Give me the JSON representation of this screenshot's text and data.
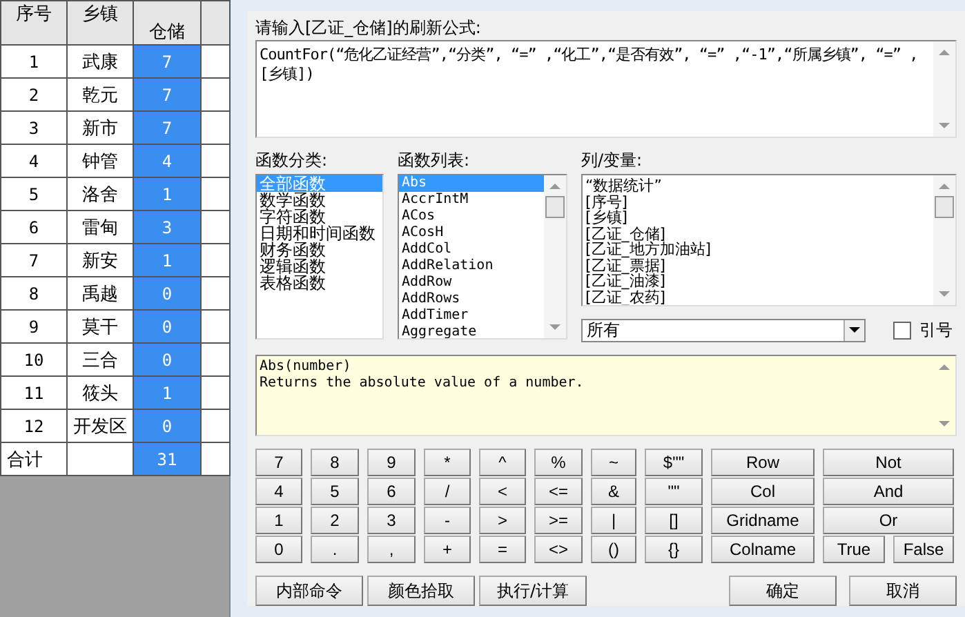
{
  "table": {
    "columns": [
      "序号",
      "乡镇",
      "仓储"
    ],
    "rows": [
      {
        "no": "1",
        "town": "武康",
        "value": "7"
      },
      {
        "no": "2",
        "town": "乾元",
        "value": "7"
      },
      {
        "no": "3",
        "town": "新市",
        "value": "7"
      },
      {
        "no": "4",
        "town": "钟管",
        "value": "4"
      },
      {
        "no": "5",
        "town": "洛舍",
        "value": "1"
      },
      {
        "no": "6",
        "town": "雷甸",
        "value": "3"
      },
      {
        "no": "7",
        "town": "新安",
        "value": "1"
      },
      {
        "no": "8",
        "town": "禹越",
        "value": "0"
      },
      {
        "no": "9",
        "town": "莫干",
        "value": "0"
      },
      {
        "no": "10",
        "town": "三合",
        "value": "0"
      },
      {
        "no": "11",
        "town": "筱头",
        "value": "1"
      },
      {
        "no": "12",
        "town": "开发区",
        "value": "0"
      }
    ],
    "total": {
      "label": "合计",
      "value": "31"
    }
  },
  "dialog": {
    "prompt": "请输入[乙证_仓储]的刷新公式:",
    "formula": "CountFor(“危化乙证经营”,“分类”, “=” ,“化工”,“是否有效”, “=” ,“-1”,“所属乡镇”, “=” ,[乡镇])",
    "category_label": "函数分类:",
    "categories": [
      {
        "label": "全部函数",
        "selected": true
      },
      {
        "label": "数学函数",
        "selected": false
      },
      {
        "label": "字符函数",
        "selected": false
      },
      {
        "label": "日期和时间函数",
        "selected": false
      },
      {
        "label": "财务函数",
        "selected": false
      },
      {
        "label": "逻辑函数",
        "selected": false
      },
      {
        "label": "表格函数",
        "selected": false
      }
    ],
    "function_label": "函数列表:",
    "functions": [
      {
        "label": "Abs",
        "selected": true
      },
      {
        "label": "AccrIntM",
        "selected": false
      },
      {
        "label": "ACos",
        "selected": false
      },
      {
        "label": "ACosH",
        "selected": false
      },
      {
        "label": "AddCol",
        "selected": false
      },
      {
        "label": "AddRelation",
        "selected": false
      },
      {
        "label": "AddRow",
        "selected": false
      },
      {
        "label": "AddRows",
        "selected": false
      },
      {
        "label": "AddTimer",
        "selected": false
      },
      {
        "label": "Aggregate",
        "selected": false
      }
    ],
    "variable_label": "列/变量:",
    "variables": [
      "“数据统计”",
      "[序号]",
      "[乡镇]",
      "[乙证_仓储]",
      "[乙证_地方加油站]",
      "[乙证_票据]",
      "[乙证_油漆]",
      "[乙证_农药]"
    ],
    "variable_filter": "所有",
    "quote": {
      "label": "引号",
      "checked": false
    },
    "help": [
      "Abs(number)",
      "Returns the absolute value of a number."
    ],
    "keypad": [
      [
        {
          "label": "7",
          "kind": "key"
        },
        {
          "label": "8",
          "kind": "key"
        },
        {
          "label": "9",
          "kind": "key"
        },
        {
          "label": "*",
          "kind": "key"
        },
        {
          "label": "^",
          "kind": "key"
        },
        {
          "label": "%",
          "kind": "key"
        },
        {
          "label": "~",
          "kind": "key"
        },
        {
          "label": "$\"\"",
          "kind": "key"
        },
        {
          "label": "Row",
          "kind": "key"
        },
        {
          "label": "Not",
          "kind": "wide"
        }
      ],
      [
        {
          "label": "4",
          "kind": "key"
        },
        {
          "label": "5",
          "kind": "key"
        },
        {
          "label": "6",
          "kind": "key"
        },
        {
          "label": "/",
          "kind": "key"
        },
        {
          "label": "<",
          "kind": "key"
        },
        {
          "label": "<=",
          "kind": "key"
        },
        {
          "label": "&",
          "kind": "key"
        },
        {
          "label": "\"\"",
          "kind": "key"
        },
        {
          "label": "Col",
          "kind": "key"
        },
        {
          "label": "And",
          "kind": "wide"
        }
      ],
      [
        {
          "label": "1",
          "kind": "key"
        },
        {
          "label": "2",
          "kind": "key"
        },
        {
          "label": "3",
          "kind": "key"
        },
        {
          "label": "-",
          "kind": "key"
        },
        {
          "label": ">",
          "kind": "key"
        },
        {
          "label": ">=",
          "kind": "key"
        },
        {
          "label": "|",
          "kind": "key"
        },
        {
          "label": "[]",
          "kind": "key"
        },
        {
          "label": "Gridname",
          "kind": "key"
        },
        {
          "label": "Or",
          "kind": "wide"
        }
      ],
      [
        {
          "label": "0",
          "kind": "key"
        },
        {
          "label": ".",
          "kind": "key"
        },
        {
          "label": ",",
          "kind": "key"
        },
        {
          "label": "+",
          "kind": "key"
        },
        {
          "label": "=",
          "kind": "key"
        },
        {
          "label": "<>",
          "kind": "key"
        },
        {
          "label": "()",
          "kind": "key"
        },
        {
          "label": "{}",
          "kind": "key"
        },
        {
          "label": "Colname",
          "kind": "key"
        },
        {
          "label": "True",
          "kind": "key"
        },
        {
          "label": "False",
          "kind": "key"
        }
      ]
    ],
    "tools": [
      "内部命令",
      "颜色拾取",
      "执行/计算"
    ],
    "buttons": [
      "确定",
      "取消"
    ]
  }
}
